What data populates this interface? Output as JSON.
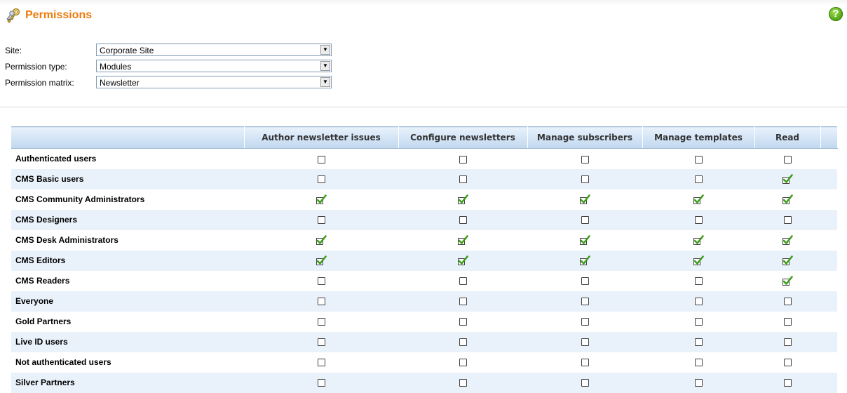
{
  "header": {
    "title": "Permissions",
    "icon": "keys-icon",
    "help_icon": "help-icon",
    "help_glyph": "?"
  },
  "filters": {
    "site": {
      "label": "Site:",
      "value": "Corporate Site"
    },
    "permission_type": {
      "label": "Permission type:",
      "value": "Modules"
    },
    "permission_matrix": {
      "label": "Permission matrix:",
      "value": "Newsletter"
    }
  },
  "matrix": {
    "columns": [
      "Author newsletter issues",
      "Configure newsletters",
      "Manage subscribers",
      "Manage templates",
      "Read"
    ],
    "rows": [
      {
        "name": "Authenticated users",
        "values": [
          false,
          false,
          false,
          false,
          false
        ]
      },
      {
        "name": "CMS Basic users",
        "values": [
          false,
          false,
          false,
          false,
          true
        ]
      },
      {
        "name": "CMS Community Administrators",
        "values": [
          true,
          true,
          true,
          true,
          true
        ]
      },
      {
        "name": "CMS Designers",
        "values": [
          false,
          false,
          false,
          false,
          false
        ]
      },
      {
        "name": "CMS Desk Administrators",
        "values": [
          true,
          true,
          true,
          true,
          true
        ]
      },
      {
        "name": "CMS Editors",
        "values": [
          true,
          true,
          true,
          true,
          true
        ]
      },
      {
        "name": "CMS Readers",
        "values": [
          false,
          false,
          false,
          false,
          true
        ]
      },
      {
        "name": "Everyone",
        "values": [
          false,
          false,
          false,
          false,
          false
        ]
      },
      {
        "name": "Gold Partners",
        "values": [
          false,
          false,
          false,
          false,
          false
        ]
      },
      {
        "name": "Live ID users",
        "values": [
          false,
          false,
          false,
          false,
          false
        ]
      },
      {
        "name": "Not authenticated users",
        "values": [
          false,
          false,
          false,
          false,
          false
        ]
      },
      {
        "name": "Silver Partners",
        "values": [
          false,
          false,
          false,
          false,
          false
        ]
      }
    ]
  },
  "colors": {
    "title": "#ee7b0c",
    "header_gradient_top": "#e8f1fb",
    "header_gradient_bottom": "#c2d7ee",
    "alt_row": "#e9f1fa",
    "check_green": "#3f9d1c"
  }
}
